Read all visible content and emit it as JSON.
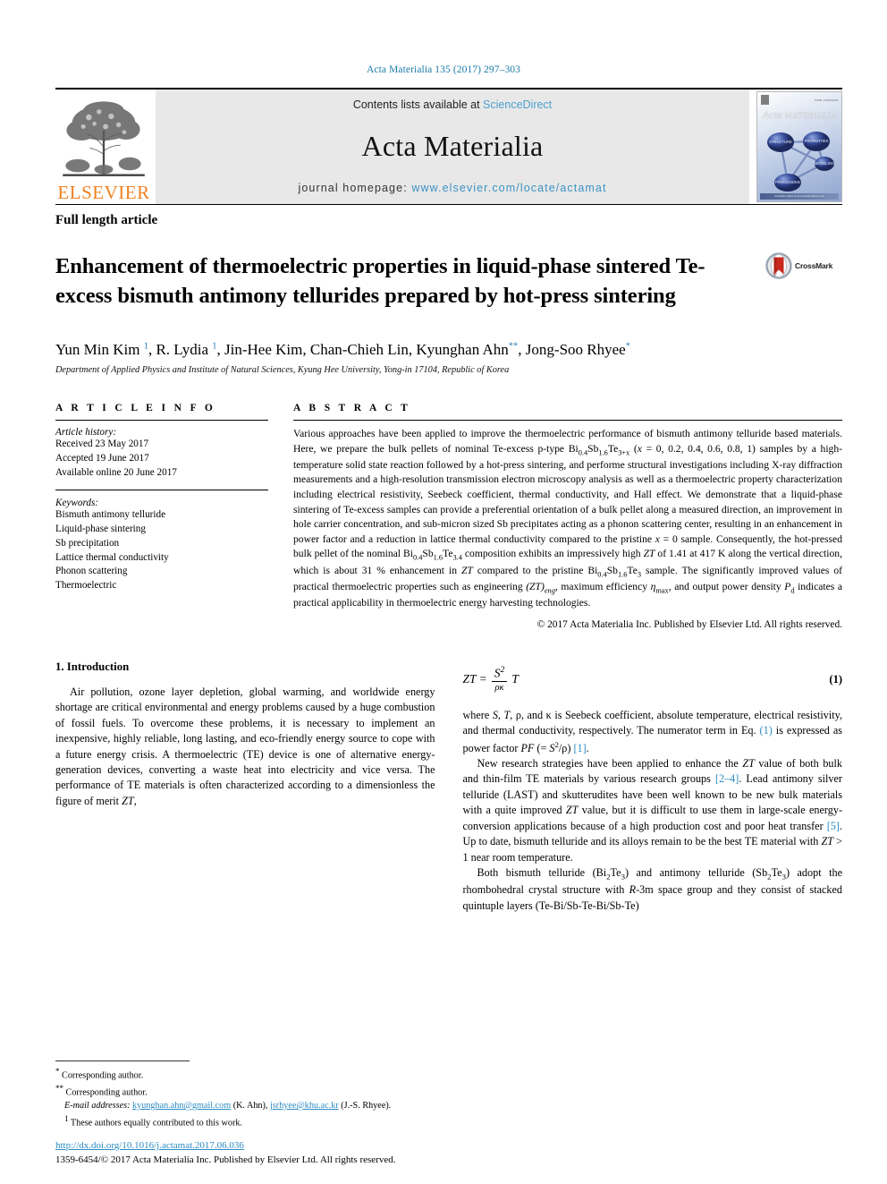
{
  "running_head": "Acta Materialia 135 (2017) 297–303",
  "masthead": {
    "elsevier_wordmark": "ELSEVIER",
    "contents_prefix": "Contents lists available at ",
    "contents_link": "ScienceDirect",
    "journal_name": "Acta Materialia",
    "homepage_prefix": "journal homepage: ",
    "homepage_url": "www.elsevier.com/locate/actamat",
    "cover": {
      "title_main": "Acta",
      "title_sub": "MATERIALIA",
      "nodes": [
        "STRUCTURE",
        "PROPERTIES",
        "MODELING",
        "PROCESSING"
      ]
    }
  },
  "article": {
    "type": "Full length article",
    "title": "Enhancement of thermoelectric properties in liquid-phase sintered Te-excess bismuth antimony tellurides prepared by hot-press sintering",
    "crossmark_label": "CrossMark",
    "authors_html": "Yun Min Kim <sup class=\"blue\">1</sup>, R. Lydia <sup class=\"blue\">1</sup>, Jin-Hee Kim, Chan-Chieh Lin, Kyunghan Ahn<sup class=\"blue\">**</sup>, Jong-Soo Rhyee<sup class=\"blue\">*</sup>",
    "affiliation": "Department of Applied Physics and Institute of Natural Sciences, Kyung Hee University, Yong-in 17104, Republic of Korea"
  },
  "article_info": {
    "heading": "A R T I C L E   I N F O",
    "history_title": "Article history:",
    "history": [
      "Received 23 May 2017",
      "Accepted 19 June 2017",
      "Available online 20 June 2017"
    ],
    "keywords_title": "Keywords:",
    "keywords": [
      "Bismuth antimony telluride",
      "Liquid-phase sintering",
      "Sb precipitation",
      "Lattice thermal conductivity",
      "Phonon scattering",
      "Thermoelectric"
    ]
  },
  "abstract": {
    "heading": "A B S T R A C T",
    "body_html": "Various approaches have been applied to improve the thermoelectric performance of bismuth antimony telluride based materials. Here, we prepare the bulk pellets of nominal Te-excess p-type Bi<sub>0.4</sub>Sb<sub>1.6</sub>Te<sub>3+x</sub> (<span class=\"ital\">x</span> = 0, 0.2, 0.4, 0.6, 0.8, 1) samples by a high-temperature solid state reaction followed by a hot-press sintering, and performe structural investigations including X-ray diffraction measurements and a high-resolution transmission electron microscopy analysis as well as a thermoelectric property characterization including electrical resistivity, Seebeck coefficient, thermal conductivity, and Hall effect. We demonstrate that a liquid-phase sintering of Te-excess samples can provide a preferential orientation of a bulk pellet along a measured direction, an improvement in hole carrier concentration, and sub-micron sized Sb precipitates acting as a phonon scattering center, resulting in an enhancement in power factor and a reduction in lattice thermal conductivity compared to the pristine <span class=\"ital\">x</span> = 0 sample. Consequently, the hot-pressed bulk pellet of the nominal Bi<sub>0.4</sub>Sb<sub>1.6</sub>Te<sub>3.4</sub> composition exhibits an impressively high <span class=\"ital\">ZT</span> of 1.41 at 417 K along the vertical direction, which is about 31 % enhancement in <span class=\"ital\">ZT</span> compared to the pristine Bi<sub>0.4</sub>Sb<sub>1.6</sub>Te<sub>3</sub> sample. The significantly improved values of practical thermoelectric properties such as engineering <span class=\"ital\">(ZT)</span><sub><span class=\"ital\">eng</span></sub>, maximum efficiency <span class=\"ital\">η</span><sub>max</sub>, and output power density <span class=\"ital\">P</span><sub>d</sub> indicates a practical applicability in thermoelectric energy harvesting technologies.",
    "copyright": "© 2017 Acta Materialia Inc. Published by Elsevier Ltd. All rights reserved."
  },
  "body": {
    "section_heading": "1. Introduction",
    "left_para_1_html": "Air pollution, ozone layer depletion, global warming, and worldwide energy shortage are critical environmental and energy problems caused by a huge combustion of fossil fuels. To overcome these problems, it is necessary to implement an inexpensive, highly reliable, long lasting, and eco-friendly energy source to cope with a future energy crisis. A thermoelectric (TE) device is one of alternative energy-generation devices, converting a waste heat into electricity and vice versa. The performance of TE materials is often characterized according to a dimensionless the figure of merit <span class=\"ital\">ZT</span>,",
    "equation": {
      "lhs": "ZT =",
      "numerator": "S",
      "numerator_sup": "2",
      "denominator": "ρκ",
      "trailing": "T",
      "number": "(1)"
    },
    "right_para_1_html": "where <span class=\"ital\">S</span>, <span class=\"ital\">T</span>, ρ, and κ is Seebeck coefficient, absolute temperature, electrical resistivity, and thermal conductivity, respectively. The numerator term in Eq. <span class=\"cite\">(1)</span> is expressed as power factor <span class=\"ital\">PF</span> (= <span class=\"ital\">S</span><sup>2</sup>/ρ) <span class=\"cite\">[1]</span>.",
    "right_para_2_html": "New research strategies have been applied to enhance the <span class=\"ital\">ZT</span> value of both bulk and thin-film TE materials by various research groups <span class=\"cite\">[2–4]</span>. Lead antimony silver telluride (LAST) and skutterudites have been well known to be new bulk materials with a quite improved <span class=\"ital\">ZT</span> value, but it is difficult to use them in large-scale energy-conversion applications because of a high production cost and poor heat transfer <span class=\"cite\">[5]</span>. Up to date, bismuth telluride and its alloys remain to be the best TE material with <span class=\"ital\">ZT</span> &gt; 1 near room temperature.",
    "right_para_3_html": "Both bismuth telluride (Bi<sub>2</sub>Te<sub>3</sub>) and antimony telluride (Sb<sub>2</sub>Te<sub>3</sub>) adopt the rhombohedral crystal structure with <span class=\"ital\">R</span>-3m space group and they consist of stacked quintuple layers (Te-Bi/Sb-Te-Bi/Sb-Te)"
  },
  "footnotes": {
    "corresponding_1": "Corresponding author.",
    "corresponding_2": "Corresponding author.",
    "email_label": "E-mail addresses:",
    "email_1": "kyunghan.ahn@gmail.com",
    "email_1_name": "(K. Ahn),",
    "email_2": "jsrhyee@khu.ac.kr",
    "email_2_name": "(J.-S. Rhyee).",
    "equal_contribution": "These authors equally contributed to this work."
  },
  "doi_block": {
    "doi": "http://dx.doi.org/10.1016/j.actamat.2017.06.036",
    "issn_line": "1359-6454/© 2017 Acta Materialia Inc. Published by Elsevier Ltd. All rights reserved."
  },
  "colors": {
    "link_blue": "#2b8cc4",
    "running_head_blue": "#1a7ba8",
    "elsevier_orange": "#F08122",
    "masthead_gray": "#e8e8e8"
  }
}
